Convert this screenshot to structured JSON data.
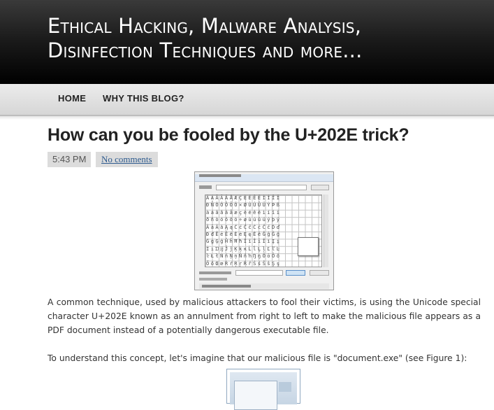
{
  "header": {
    "blog_title": "Ethical Hacking, Malware Analysis,\nDisinfection Techniques and more..."
  },
  "nav": {
    "items": [
      {
        "label": "HOME"
      },
      {
        "label": "WHY THIS BLOG?"
      }
    ]
  },
  "post": {
    "title": "How can you be fooled by the U+202E trick?",
    "time": "5:43 PM",
    "comments_label": "No comments",
    "paragraph1": "A common technique, used by malicious attackers to fool their victims, is using the Unicode special character U+202E known as an annulment from right to left to make the malicious file appears as a PDF document instead of a potentially dangerous executable file.",
    "paragraph2": "To understand this concept, let's imagine that our malicious file is \"document.exe\" (see Figure 1):"
  },
  "figure_charmap": {
    "glyph_rows": "ÀÁÂÃÄÅÆÇÈÉÊËÌÍÎÏ ÐÑÒÓÔÕÖ×ØÙÚÛÜÝÞß àáâãäåæçèéêëìíîï ðñòóôõö÷øùúûüýþÿ ĀāĂăĄąĆćĈĉĊċČčĎď ĐđĒēĔĕĖėĘęĚěĜĝĞğ ĠġĢģĤĥĦħĨĩĪīĬĭĮį İıĲĳĴĵĶķĸĹĺĻļĽľĿ ŀŁłŃńŅņŇňŉŊŋŌōŎŏ ŐőŒœŔŕŖŗŘřŚśŜŝŞş ŠšŢţŤťŦŧŨũŪūŬŭŮů"
  }
}
